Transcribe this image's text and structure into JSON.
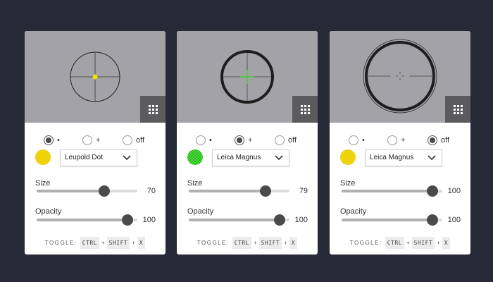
{
  "radio_labels": {
    "dot": "•",
    "plus": "+",
    "off": "off"
  },
  "toggle": {
    "label": "TOGGLE:",
    "keys": [
      "CTRL",
      "SHIFT",
      "X"
    ],
    "separator": "+"
  },
  "field_labels": {
    "size": "Size",
    "opacity": "Opacity"
  },
  "cards": [
    {
      "reticle": "dot-crosshair",
      "selected_style": "dot",
      "color": {
        "name": "yellow",
        "hex": "#f5dc14"
      },
      "preset": "Leupold Dot",
      "size": {
        "value": 70,
        "fraction": 0.67
      },
      "opacity": {
        "value": 100,
        "fraction": 0.9
      }
    },
    {
      "reticle": "plus-crosshair",
      "selected_style": "plus",
      "color": {
        "name": "green",
        "hex": "#4fdc3a"
      },
      "preset": "Leica Magnus",
      "size": {
        "value": 79,
        "fraction": 0.76
      },
      "opacity": {
        "value": 100,
        "fraction": 0.9
      }
    },
    {
      "reticle": "off-crosshair",
      "selected_style": "off",
      "color": {
        "name": "yellow",
        "hex": "#f5dc14"
      },
      "preset": "Leica Magnus",
      "size": {
        "value": 100,
        "fraction": 0.9
      },
      "opacity": {
        "value": 100,
        "fraction": 0.9
      }
    }
  ],
  "colors": {
    "background": "#272a36",
    "preview_bg": "#a3a3a7",
    "grid_button": "#5b5b5e",
    "thumb": "#4a4a4a"
  }
}
